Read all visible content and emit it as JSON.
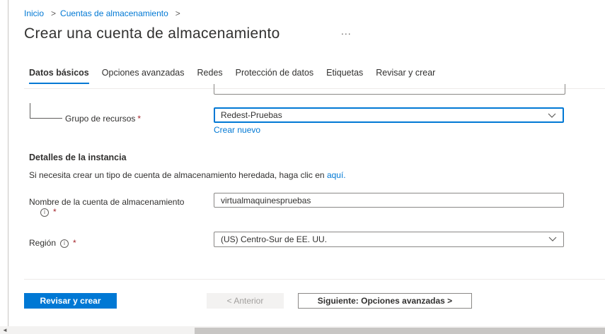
{
  "breadcrumb": {
    "home": "Inicio",
    "separator": ">",
    "parent": "Cuentas de almacenamiento",
    "trailing": ">"
  },
  "title": "Crear una cuenta de almacenamiento",
  "more_label": "...",
  "tabs": [
    {
      "label": "Datos básicos",
      "active": true
    },
    {
      "label": "Opciones avanzadas"
    },
    {
      "label": "Redes"
    },
    {
      "label": "Protección de datos"
    },
    {
      "label": "Etiquetas"
    },
    {
      "label": "Revisar y crear"
    }
  ],
  "resource_group": {
    "label": "Grupo de recursos",
    "required_mark": "*",
    "value": "Redest-Pruebas",
    "create_new": "Crear nuevo"
  },
  "instance": {
    "title": "Detalles de la instancia",
    "helper_text": "Si necesita crear un tipo de cuenta de almacenamiento heredada, haga clic en ",
    "helper_link": "aquí.",
    "account_name": {
      "label": "Nombre de la cuenta de almacenamiento",
      "info": "i",
      "required_mark": "*",
      "value": "virtualmaquinespruebas"
    },
    "region": {
      "label": "Región",
      "info": "i",
      "required_mark": "*",
      "value": "(US) Centro-Sur de EE. UU."
    }
  },
  "footer": {
    "review_create": "Revisar y crear",
    "previous": "< Anterior",
    "next": "Siguiente: Opciones avanzadas >"
  },
  "scrollbar": {
    "left_arrow": "◄"
  },
  "colors": {
    "accent": "#0078d4",
    "required": "#a4262c"
  }
}
